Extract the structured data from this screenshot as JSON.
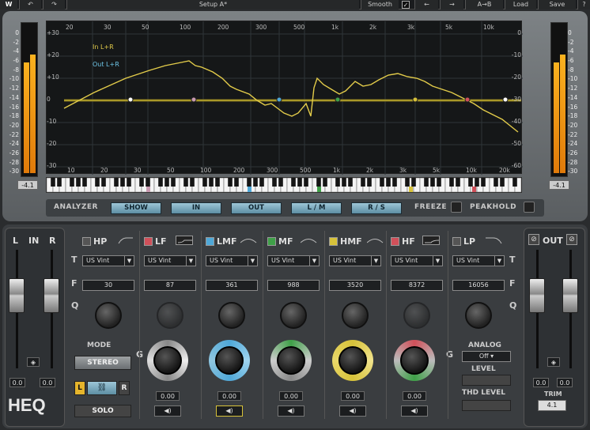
{
  "toolbar": {
    "setup_label": "Setup A*",
    "smooth_label": "Smooth",
    "smooth_check": "✓",
    "prev_label": "←",
    "next_label": "→",
    "ab_label": "A→B",
    "load_label": "Load",
    "save_label": "Save"
  },
  "analyzer": {
    "left_scale": [
      "0",
      "-2",
      "-4",
      "-6",
      "-8",
      "-10",
      "-12",
      "-14",
      "-16",
      "-18",
      "-20",
      "-22",
      "-24",
      "-26",
      "-28",
      "-30"
    ],
    "right_scale": [
      "0",
      "-2",
      "-4",
      "-6",
      "-8",
      "-10",
      "-12",
      "-14",
      "-16",
      "-18",
      "-20",
      "-22",
      "-24",
      "-26",
      "-28",
      "-30"
    ],
    "left_readout": "-4.1",
    "right_readout": "-4.1",
    "graph_left_scale": [
      "+30",
      "+20",
      "+10",
      "0",
      "-10",
      "-20",
      "-30"
    ],
    "graph_right_scale": [
      "0",
      "-10",
      "-20",
      "-30",
      "-40",
      "-50",
      "-60"
    ],
    "freq_top": [
      "20",
      "30",
      "50",
      "100",
      "200",
      "300",
      "500",
      "1k",
      "2k",
      "3k",
      "5k",
      "10k"
    ],
    "freq_bottom": [
      "10",
      "20",
      "30",
      "50",
      "100",
      "200",
      "300",
      "500",
      "1k",
      "2k",
      "3k",
      "5k",
      "10k",
      "20k"
    ],
    "legend_in": "In L+R",
    "legend_out": "Out L+R",
    "bar": {
      "label": "ANALYZER",
      "show": "SHOW",
      "in": "IN",
      "out": "OUT",
      "lm": "L / M",
      "rs": "R / S",
      "freeze": "FREEZE",
      "peakhold": "PEAKHOLD"
    }
  },
  "input": {
    "title_l": "L",
    "title_in": "IN",
    "title_r": "R",
    "value_l": "0.0",
    "value_r": "0.0"
  },
  "mode": {
    "label": "MODE",
    "stereo": "STEREO",
    "l": "L",
    "r": "R",
    "solo": "SOLO",
    "logo": "HEQ"
  },
  "bands": [
    {
      "name": "HP",
      "color": "#555555",
      "type": "",
      "freq": "30",
      "gain": ""
    },
    {
      "name": "LF",
      "color": "#d0505a",
      "type": "US Vint",
      "freq": "87",
      "gain": "0.00"
    },
    {
      "name": "LMF",
      "color": "#4fa8d8",
      "type": "US Vint",
      "freq": "361",
      "gain": "0.00"
    },
    {
      "name": "MF",
      "color": "#3fa048",
      "type": "US Vint",
      "freq": "988",
      "gain": "0.00"
    },
    {
      "name": "HMF",
      "color": "#d7c23a",
      "type": "US Vint",
      "freq": "3520",
      "gain": "0.00"
    },
    {
      "name": "HF",
      "color": "#d0505a",
      "type": "US Vint",
      "freq": "8372",
      "gain": "0.00"
    },
    {
      "name": "LP",
      "color": "#555555",
      "type": "US Vint",
      "freq": "16056",
      "gain": ""
    }
  ],
  "hp_type": "US Vint",
  "row_letters": {
    "t": "T",
    "f": "F",
    "q": "Q",
    "g": "G"
  },
  "analog": {
    "label": "ANALOG",
    "value": "Off",
    "level_label": "LEVEL",
    "thd_label": "THD LEVEL"
  },
  "output": {
    "title": "OUT",
    "value_l": "0.0",
    "value_r": "0.0",
    "trim_label": "TRIM",
    "trim_value": "4.1"
  }
}
